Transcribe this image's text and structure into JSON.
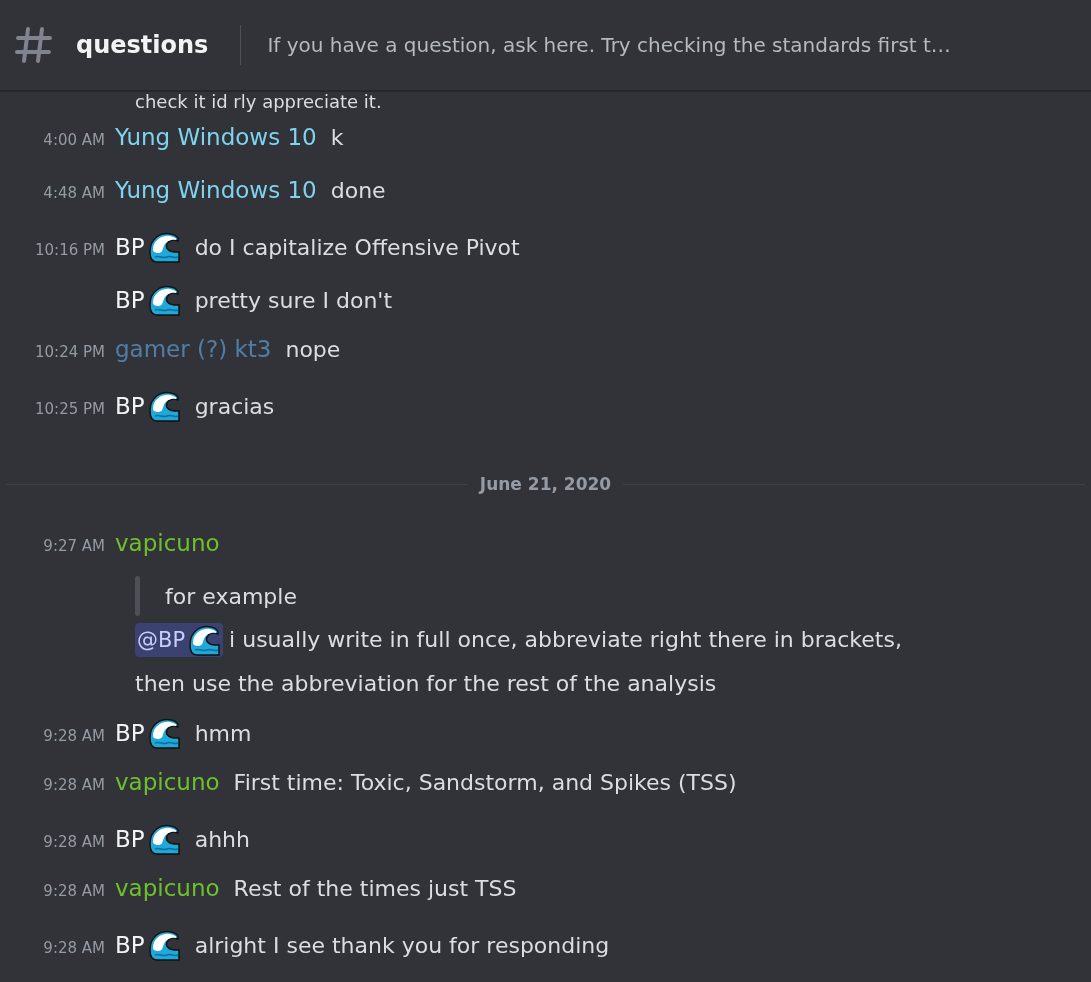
{
  "channel": {
    "name": "questions",
    "topic": "If you have a question, ask here. Try checking the standards first t…"
  },
  "clipped_line": {
    "text": "check it id rly appreciate it."
  },
  "messages": [
    {
      "kind": "inline",
      "time": "4:00 AM",
      "author": "Yung Windows 10",
      "color": "#7fd3ee",
      "emoji": false,
      "text": "k"
    },
    {
      "kind": "inline",
      "time": "4:48 AM",
      "author": "Yung Windows 10",
      "color": "#7fd3ee",
      "emoji": false,
      "text": "done"
    },
    {
      "kind": "inline",
      "time": "10:16 PM",
      "author": "BP",
      "color": "#f2f3f5",
      "emoji": true,
      "text": "do I capitalize Offensive Pivot"
    },
    {
      "kind": "inline",
      "author": "BP",
      "color": "#f2f3f5",
      "emoji": true,
      "text": "pretty sure  I don't"
    },
    {
      "kind": "inline",
      "time": "10:24 PM",
      "author": "gamer (?) kt3",
      "color": "#4f7fa6",
      "emoji": false,
      "text": "nope"
    },
    {
      "kind": "inline",
      "time": "10:25 PM",
      "author": "BP",
      "color": "#f2f3f5",
      "emoji": true,
      "text": "gracias"
    },
    {
      "kind": "divider",
      "text": "June 21, 2020"
    },
    {
      "kind": "block",
      "time": "9:27 AM",
      "author": "vapicuno",
      "color": "#6ec12c",
      "emoji": false,
      "quote": "for example",
      "mention": {
        "name": "@BP",
        "emoji": true
      },
      "text": "i usually write in full once, abbreviate right there in brackets, then use the abbreviation for the rest of the analysis"
    },
    {
      "kind": "inline",
      "time": "9:28 AM",
      "author": "BP",
      "color": "#f2f3f5",
      "emoji": true,
      "text": "hmm"
    },
    {
      "kind": "inline",
      "time": "9:28 AM",
      "author": "vapicuno",
      "color": "#6ec12c",
      "emoji": false,
      "text": "First time: Toxic, Sandstorm, and Spikes (TSS)"
    },
    {
      "kind": "inline",
      "time": "9:28 AM",
      "author": "BP",
      "color": "#f2f3f5",
      "emoji": true,
      "text": "ahhh"
    },
    {
      "kind": "inline",
      "time": "9:28 AM",
      "author": "vapicuno",
      "color": "#6ec12c",
      "emoji": false,
      "text": "Rest of the times just TSS"
    },
    {
      "kind": "inline",
      "time": "9:28 AM",
      "author": "BP",
      "color": "#f2f3f5",
      "emoji": true,
      "text": "alright I see thank you for responding"
    }
  ]
}
